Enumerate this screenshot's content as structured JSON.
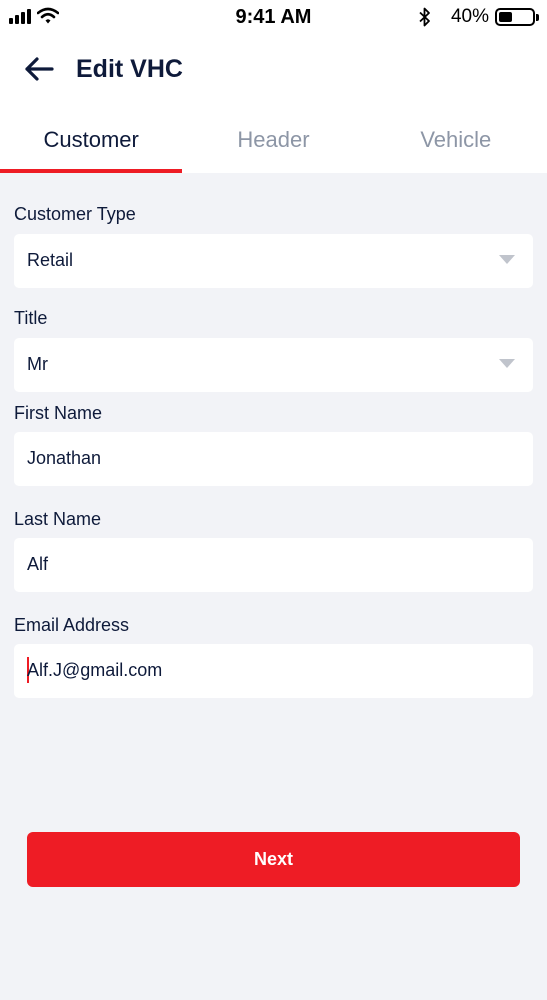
{
  "status_bar": {
    "time": "9:41 AM",
    "battery": "40%",
    "battery_level": 0.4,
    "signal_icon": "signal-bars-icon",
    "wifi_icon": "wifi-icon",
    "bluetooth_icon": "bluetooth-icon",
    "battery_icon": "battery-icon"
  },
  "header": {
    "back_icon": "arrow-left-icon",
    "title": "Edit VHC"
  },
  "tabs": [
    {
      "label": "Customer",
      "active": true
    },
    {
      "label": "Header",
      "active": false
    },
    {
      "label": "Vehicle",
      "active": false
    }
  ],
  "form": {
    "customer_type": {
      "label": "Customer Type",
      "value": "Retail",
      "icon": "dropdown-caret-icon"
    },
    "title": {
      "label": "Title",
      "value": "Mr",
      "icon": "dropdown-caret-icon"
    },
    "first_name": {
      "label": "First Name",
      "value": "Jonathan"
    },
    "last_name": {
      "label": "Last Name",
      "value": "Alf"
    },
    "email": {
      "label": "Email Address",
      "value": "Alf.J@gmail.com"
    }
  },
  "actions": {
    "next_label": "Next"
  },
  "colors": {
    "accent": "#ee1c25",
    "text": "#0e1a3a",
    "inactive_tab": "#8d96a6",
    "background": "#f2f3f7"
  }
}
